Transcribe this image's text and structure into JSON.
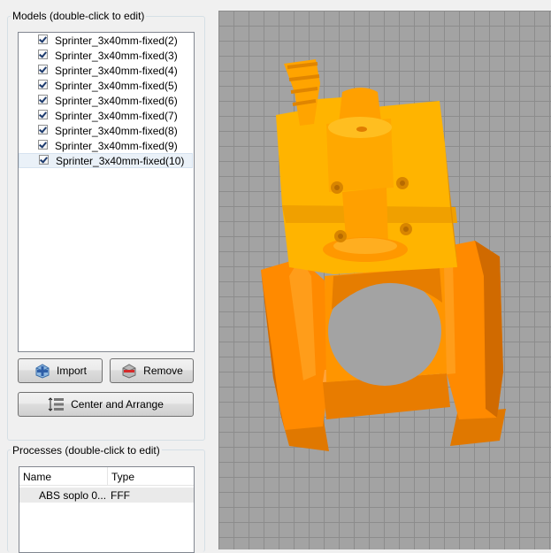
{
  "models_panel": {
    "title": "Models (double-click to edit)",
    "items": [
      {
        "label": "Sprinter_3x40mm-fixed(2)",
        "checked": true
      },
      {
        "label": "Sprinter_3x40mm-fixed(3)",
        "checked": true
      },
      {
        "label": "Sprinter_3x40mm-fixed(4)",
        "checked": true
      },
      {
        "label": "Sprinter_3x40mm-fixed(5)",
        "checked": true
      },
      {
        "label": "Sprinter_3x40mm-fixed(6)",
        "checked": true
      },
      {
        "label": "Sprinter_3x40mm-fixed(7)",
        "checked": true
      },
      {
        "label": "Sprinter_3x40mm-fixed(8)",
        "checked": true
      },
      {
        "label": "Sprinter_3x40mm-fixed(9)",
        "checked": true
      },
      {
        "label": "Sprinter_3x40mm-fixed(10)",
        "checked": true
      }
    ],
    "buttons": {
      "import_label": "Import",
      "remove_label": "Remove",
      "center_label": "Center and Arrange"
    }
  },
  "processes_panel": {
    "title": "Processes (double-click to edit)",
    "columns": [
      "Name",
      "Type"
    ],
    "rows": [
      {
        "name": "ABS soplo 0...",
        "type": "FFF"
      }
    ]
  },
  "viewport": {
    "model_color": "#ff9a00",
    "grid_color": "#8c8c8c",
    "background_color": "#a3a3a3"
  }
}
